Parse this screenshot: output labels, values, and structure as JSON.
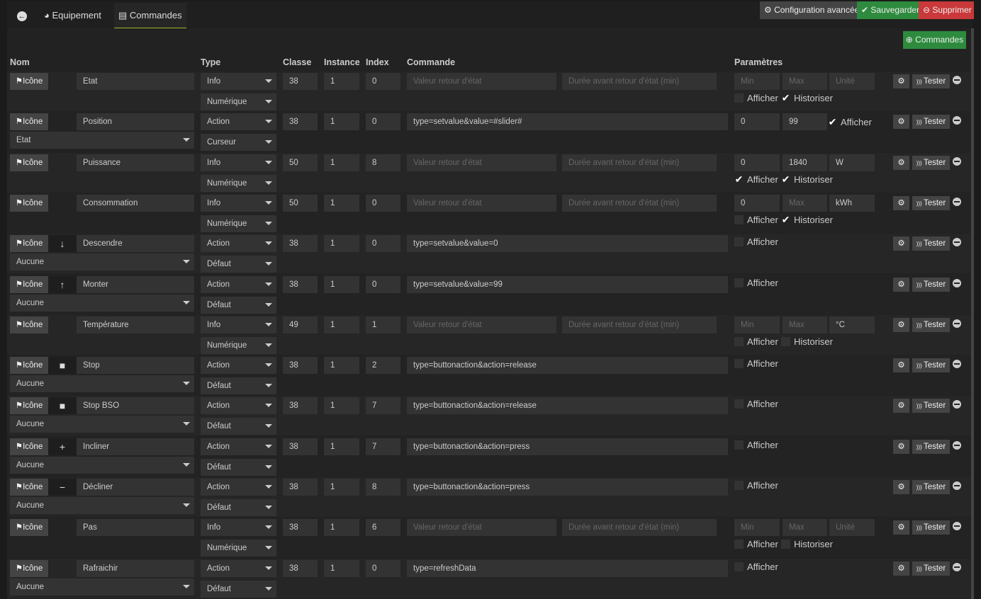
{
  "tabs": {
    "back": "←",
    "equipement": "Equipement",
    "commandes": "Commandes"
  },
  "toolbar": {
    "config": "Configuration avancée",
    "save": "Sauvegarder",
    "delete": "Supprimer",
    "add_commandes": "Commandes"
  },
  "colors": {
    "green": "#2e8b3e",
    "red": "#c9383a",
    "accent": "#9ab52a"
  },
  "headers": {
    "nom": "Nom",
    "type": "Type",
    "classe": "Classe",
    "instance": "Instance",
    "index": "Index",
    "commande": "Commande",
    "parametres": "Paramètres"
  },
  "labels": {
    "icone": "Icône",
    "tester": "Tester",
    "afficher": "Afficher",
    "historiser": "Historiser",
    "ph_valeur": "Valeur retour d'état",
    "ph_duree": "Durée avant retour d'état (min)",
    "ph_min": "Min",
    "ph_max": "Max",
    "ph_unite": "Unité"
  },
  "rows": [
    {
      "name": "Etat",
      "icon": "",
      "type": "Info",
      "subtype": "Numérique",
      "classe": "38",
      "instance": "1",
      "index": "0",
      "min": "",
      "max": "",
      "unit": "",
      "afficher": false,
      "historiser": true
    },
    {
      "name": "Position",
      "icon": "",
      "type": "Action",
      "subtype": "Curseur",
      "classe": "38",
      "instance": "1",
      "index": "0",
      "commande": "type=setvalue&value=#slider#",
      "link": "Etat",
      "min": "0",
      "max": "99",
      "afficher": true,
      "slider": true
    },
    {
      "name": "Puissance",
      "icon": "",
      "type": "Info",
      "subtype": "Numérique",
      "classe": "50",
      "instance": "1",
      "index": "8",
      "min": "0",
      "max": "1840",
      "unit": "W",
      "afficher": true,
      "historiser": true
    },
    {
      "name": "Consommation",
      "icon": "",
      "type": "Info",
      "subtype": "Numérique",
      "classe": "50",
      "instance": "1",
      "index": "0",
      "min": "0",
      "max": "",
      "unit": "kWh",
      "afficher": false,
      "historiser": true
    },
    {
      "name": "Descendre",
      "icon": "↓",
      "type": "Action",
      "subtype": "Défaut",
      "classe": "38",
      "instance": "1",
      "index": "0",
      "commande": "type=setvalue&value=0",
      "link": "Aucune",
      "afficher": false
    },
    {
      "name": "Monter",
      "icon": "↑",
      "type": "Action",
      "subtype": "Défaut",
      "classe": "38",
      "instance": "1",
      "index": "0",
      "commande": "type=setvalue&value=99",
      "link": "Aucune",
      "afficher": false
    },
    {
      "name": "Température",
      "icon": "",
      "type": "Info",
      "subtype": "Numérique",
      "classe": "49",
      "instance": "1",
      "index": "1",
      "min": "",
      "max": "",
      "unit": "°C",
      "afficher": false,
      "historiser": false
    },
    {
      "name": "Stop",
      "icon": "■",
      "type": "Action",
      "subtype": "Défaut",
      "classe": "38",
      "instance": "1",
      "index": "2",
      "commande": "type=buttonaction&action=release",
      "link": "Aucune",
      "afficher": false
    },
    {
      "name": "Stop BSO",
      "icon": "■",
      "type": "Action",
      "subtype": "Défaut",
      "classe": "38",
      "instance": "1",
      "index": "7",
      "commande": "type=buttonaction&action=release",
      "link": "Aucune",
      "afficher": false
    },
    {
      "name": "Incliner",
      "icon": "+",
      "type": "Action",
      "subtype": "Défaut",
      "classe": "38",
      "instance": "1",
      "index": "7",
      "commande": "type=buttonaction&action=press",
      "link": "Aucune",
      "afficher": false
    },
    {
      "name": "Décliner",
      "icon": "−",
      "type": "Action",
      "subtype": "Défaut",
      "classe": "38",
      "instance": "1",
      "index": "8",
      "commande": "type=buttonaction&action=press",
      "link": "Aucune",
      "afficher": false
    },
    {
      "name": "Pas",
      "icon": "",
      "type": "Info",
      "subtype": "Numérique",
      "classe": "38",
      "instance": "1",
      "index": "6",
      "min": "",
      "max": "",
      "unit": "",
      "afficher": false,
      "historiser": false
    },
    {
      "name": "Rafraichir",
      "icon": "",
      "type": "Action",
      "subtype": "Défaut",
      "classe": "38",
      "instance": "1",
      "index": "0",
      "commande": "type=refreshData",
      "link": "Aucune",
      "afficher": false
    }
  ]
}
